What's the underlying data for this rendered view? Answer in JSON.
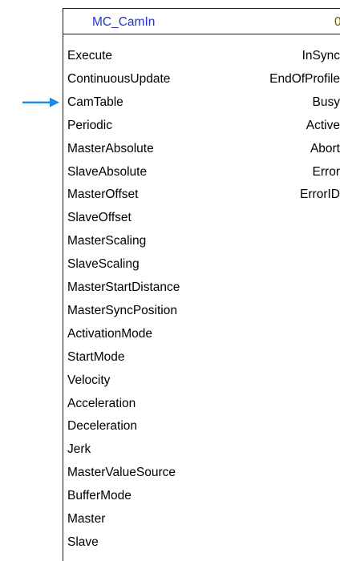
{
  "block": {
    "name": "MC_CamIn",
    "instance": "0",
    "name_color": "#2233cc",
    "arrow_color": "#1e88e5",
    "highlighted_input": "CamTable"
  },
  "inputs": [
    "Execute",
    "ContinuousUpdate",
    "CamTable",
    "Periodic",
    "MasterAbsolute",
    "SlaveAbsolute",
    "MasterOffset",
    "SlaveOffset",
    "MasterScaling",
    "SlaveScaling",
    "MasterStartDistance",
    "MasterSyncPosition",
    "ActivationMode",
    "StartMode",
    "Velocity",
    "Acceleration",
    "Deceleration",
    "Jerk",
    "MasterValueSource",
    "BufferMode",
    "Master",
    "Slave"
  ],
  "outputs": [
    "InSync",
    "EndOfProfile",
    "Busy",
    "Active",
    "Abort",
    "Error",
    "ErrorID"
  ]
}
